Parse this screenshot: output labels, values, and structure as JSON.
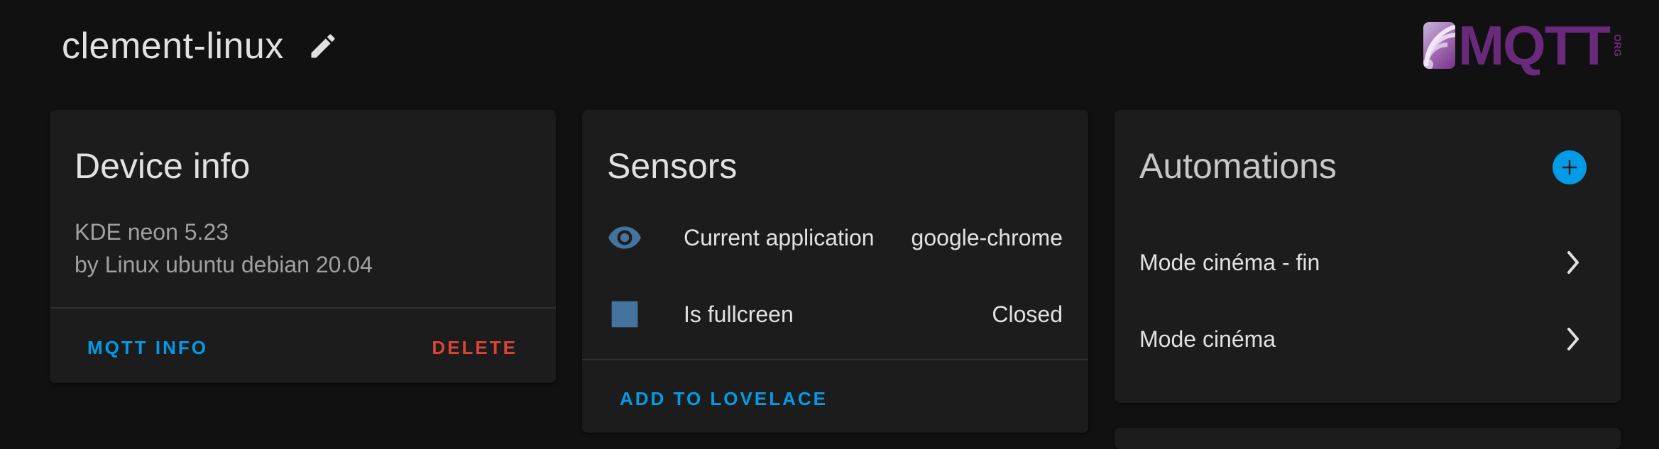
{
  "header": {
    "device_name": "clement-linux",
    "edit_icon": "pencil-icon"
  },
  "logo": {
    "text": "MQTT",
    "org": "ORG"
  },
  "device_info": {
    "title": "Device info",
    "model": "KDE neon 5.23",
    "manufacturer": "by Linux ubuntu debian 20.04",
    "mqtt_info_label": "MQTT INFO",
    "delete_label": "DELETE"
  },
  "sensors": {
    "title": "Sensors",
    "items": [
      {
        "name": "Current application",
        "state": "google-chrome",
        "icon": "eye-icon"
      },
      {
        "name": "Is fullcreen",
        "state": "Closed",
        "icon": "square-icon"
      }
    ],
    "add_label": "ADD TO LOVELACE"
  },
  "automations": {
    "title": "Automations",
    "items": [
      {
        "name": "Mode cinéma - fin"
      },
      {
        "name": "Mode cinéma"
      }
    ]
  },
  "colors": {
    "background": "#111111",
    "card": "#1c1c1c",
    "accent": "#039be5",
    "delete": "#db4437",
    "sensor_icon": "#44739e"
  }
}
